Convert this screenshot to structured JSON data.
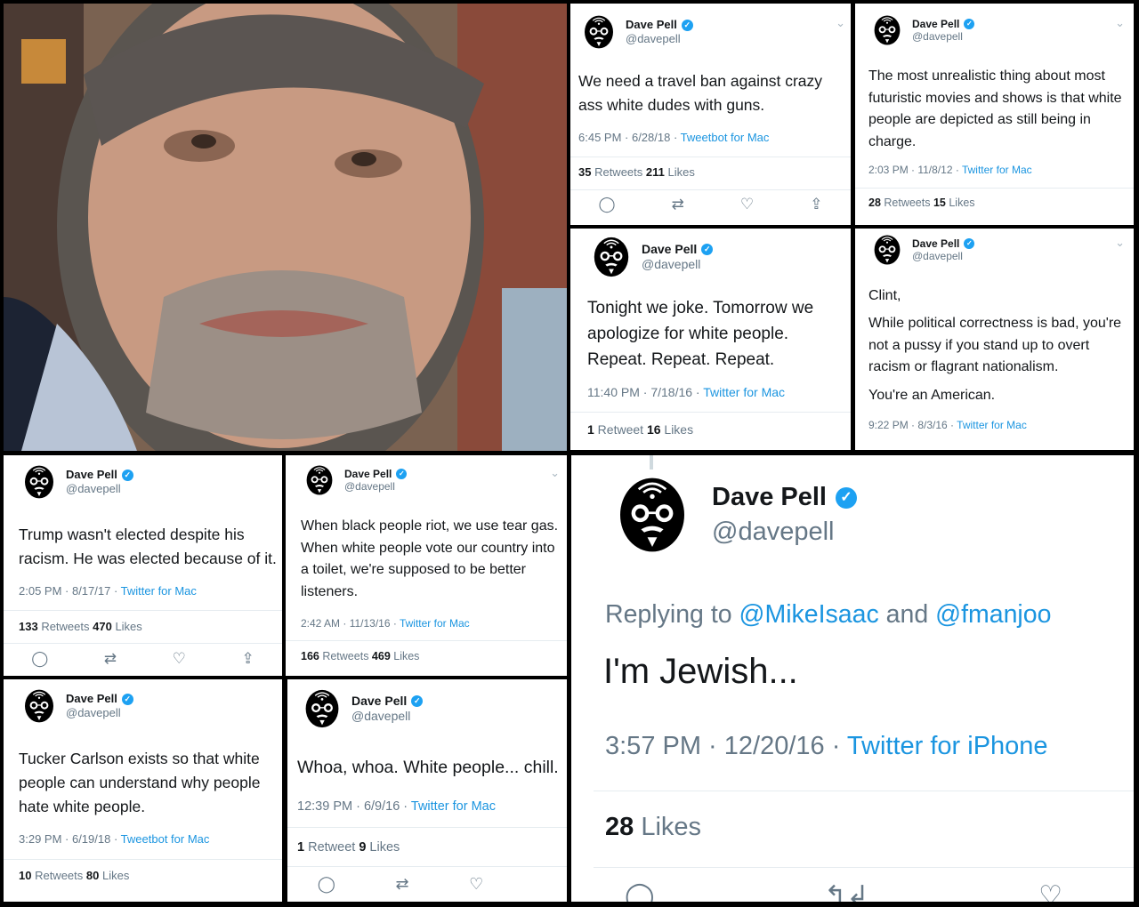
{
  "author": {
    "name": "Dave Pell",
    "handle": "@davepell",
    "verified_mark": "✓"
  },
  "icons": {
    "reply": "reply-icon",
    "retweet": "retweet-icon",
    "like": "like-icon",
    "share": "share-icon",
    "caret": "chevron-down-icon"
  },
  "glyphs": {
    "reply": "◯",
    "retweet": "⇄",
    "like": "♡",
    "share": "⇪",
    "caret": "⌄",
    "reply_big": "◯",
    "retweet_big": "↰↲",
    "like_big": "♡"
  },
  "colors": {
    "accent": "#1da1f2",
    "link": "#1b95e0",
    "meta": "#657786",
    "text": "#14171a"
  },
  "tweets": {
    "t1": {
      "text": "We need a travel ban against crazy ass white dudes with guns.",
      "time": "6:45 PM · 6/28/18 · ",
      "source": "Tweetbot for Mac",
      "retweets": "35",
      "retweets_label": " Retweets ",
      "likes": "211",
      "likes_label": " Likes"
    },
    "t2": {
      "text": "The most unrealistic thing about most futuristic movies and shows is that white people are depicted as still being in charge.",
      "time": "2:03 PM · 11/8/12 · ",
      "source": "Twitter for Mac",
      "retweets": "28",
      "retweets_label": " Retweets ",
      "likes": "15",
      "likes_label": " Likes"
    },
    "t3": {
      "text": "Tonight we joke. Tomorrow we apologize for white people. Repeat. Repeat. Repeat.",
      "time": "11:40 PM · 7/18/16 · ",
      "source": "Twitter for Mac",
      "retweets": "1",
      "retweets_label": " Retweet ",
      "likes": "16",
      "likes_label": " Likes"
    },
    "t4": {
      "line1": "Clint,",
      "line2": "While political correctness is bad, you're not a pussy if you stand up to overt racism or flagrant nationalism.",
      "line3": "You're an American.",
      "time": "9:22 PM · 8/3/16 · ",
      "source": "Twitter for Mac"
    },
    "t5": {
      "text": "Trump wasn't elected despite his racism. He was elected because of it.",
      "time": "2:05 PM · 8/17/17 · ",
      "source": "Twitter for Mac",
      "retweets": "133",
      "retweets_label": " Retweets ",
      "likes": "470",
      "likes_label": " Likes"
    },
    "t6": {
      "text": "When black people riot, we use tear gas. When white people vote our country into a toilet, we're supposed to be better listeners.",
      "time": "2:42 AM · 11/13/16 · ",
      "source": "Twitter for Mac",
      "retweets": "166",
      "retweets_label": " Retweets ",
      "likes": "469",
      "likes_label": " Likes"
    },
    "t7": {
      "text": "Tucker Carlson exists so that white people can understand why people hate white people.",
      "time": "3:29 PM · 6/19/18 · ",
      "source": "Tweetbot for Mac",
      "retweets": "10",
      "retweets_label": " Retweets ",
      "likes": "80",
      "likes_label": " Likes"
    },
    "t8": {
      "text": "Whoa, whoa. White people... chill.",
      "time": "12:39 PM · 6/9/16 · ",
      "source": "Twitter for Mac",
      "retweets": "1",
      "retweets_label": " Retweet ",
      "likes": "9",
      "likes_label": " Likes"
    },
    "t9": {
      "replying": "Replying to ",
      "mention1": "@MikeIsaac",
      "and": " and ",
      "mention2": "@fmanjoo",
      "text": "I'm Jewish...",
      "time": "3:57 PM · 12/20/16 · ",
      "source": "Twitter for iPhone",
      "likes": "28",
      "likes_label": " Likes"
    }
  }
}
